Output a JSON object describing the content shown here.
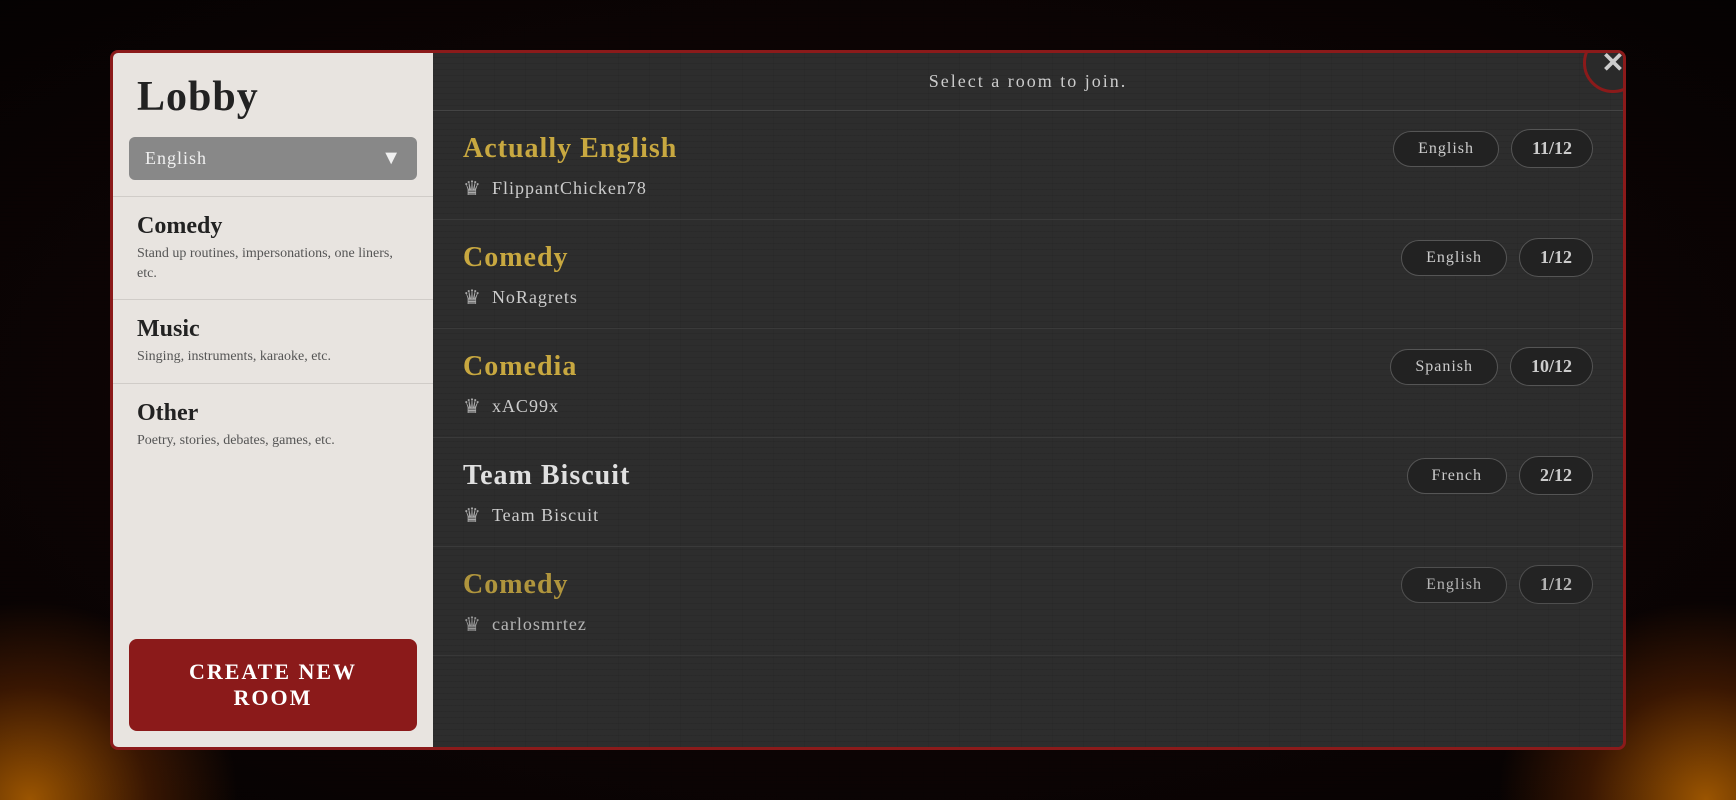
{
  "background": {
    "color": "#1a0a0a"
  },
  "modal": {
    "close_button": "✕"
  },
  "sidebar": {
    "title": "Lobby",
    "language_dropdown": {
      "value": "English",
      "arrow": "▼"
    },
    "categories": [
      {
        "name": "Comedy",
        "description": "Stand up routines, impersonations, one liners, etc."
      },
      {
        "name": "Music",
        "description": "Singing, instruments, karaoke, etc."
      },
      {
        "name": "Other",
        "description": "Poetry, stories, debates, games, etc."
      }
    ],
    "create_button_label": "Create New Room"
  },
  "main": {
    "header": "Select a room to join.",
    "rooms": [
      {
        "name": "Actually English",
        "name_style": "gold",
        "host": "FlippantChicken78",
        "language": "English",
        "count": "11/12"
      },
      {
        "name": "Comedy",
        "name_style": "gold",
        "host": "NoRagrets",
        "language": "English",
        "count": "1/12"
      },
      {
        "name": "Comedia",
        "name_style": "gold",
        "host": "xAC99x",
        "language": "Spanish",
        "count": "10/12"
      },
      {
        "name": "Team Biscuit",
        "name_style": "white",
        "host": "Team Biscuit",
        "language": "French",
        "count": "2/12"
      },
      {
        "name": "Comedy",
        "name_style": "gold",
        "host": "carlosmrtez",
        "language": "English",
        "count": "1/12"
      }
    ]
  }
}
